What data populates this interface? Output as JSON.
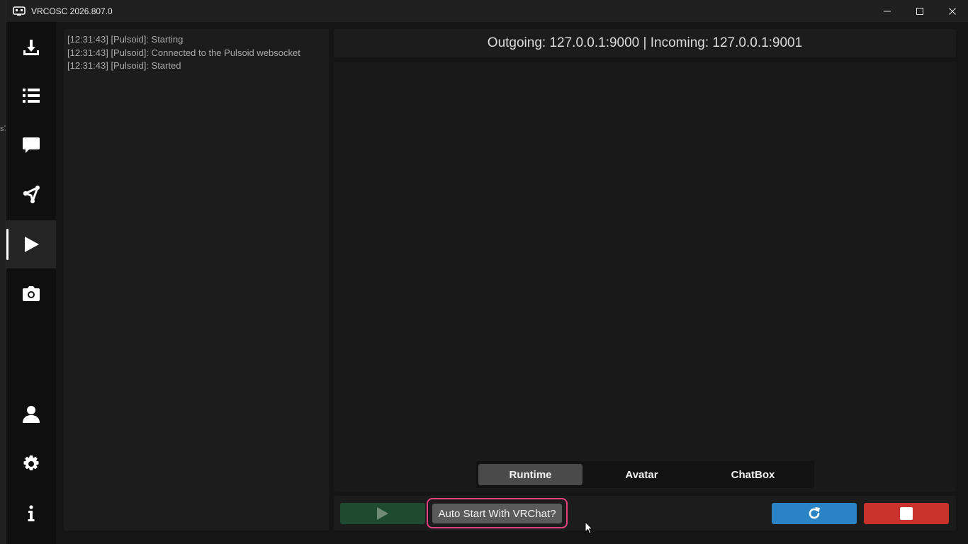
{
  "window": {
    "title": "VRCOSC 2026.807.0"
  },
  "desktop": {
    "edge_fragment": "s7"
  },
  "sidebar": {
    "items": [
      {
        "icon": "download-icon",
        "active": false
      },
      {
        "icon": "list-icon",
        "active": false
      },
      {
        "icon": "chat-bubble-icon",
        "active": false
      },
      {
        "icon": "node-graph-icon",
        "active": false
      },
      {
        "icon": "play-icon",
        "active": true
      },
      {
        "icon": "camera-icon",
        "active": false
      },
      {
        "icon": "user-icon",
        "active": false
      },
      {
        "icon": "settings-gear-icon",
        "active": false
      },
      {
        "icon": "info-icon",
        "active": false
      }
    ]
  },
  "log": {
    "lines": [
      "[12:31:43] [Pulsoid]: Starting",
      "[12:31:43] [Pulsoid]: Connected to the Pulsoid websocket",
      "[12:31:43] [Pulsoid]: Started"
    ]
  },
  "status": {
    "text": "Outgoing: 127.0.0.1:9000 | Incoming: 127.0.0.1:9001"
  },
  "tabs": [
    {
      "label": "Runtime",
      "active": true
    },
    {
      "label": "Avatar",
      "active": false
    },
    {
      "label": "ChatBox",
      "active": false
    }
  ],
  "controls": {
    "play_icon": "play-icon",
    "auto_start_label": "Auto Start With VRChat?",
    "restart_icon": "restart-icon",
    "stop_icon": "stop-icon"
  },
  "colors": {
    "play_button": "#1e4a30",
    "restart_button": "#2a83c4",
    "stop_button": "#c9332b",
    "highlight_outline": "#e2437e"
  }
}
